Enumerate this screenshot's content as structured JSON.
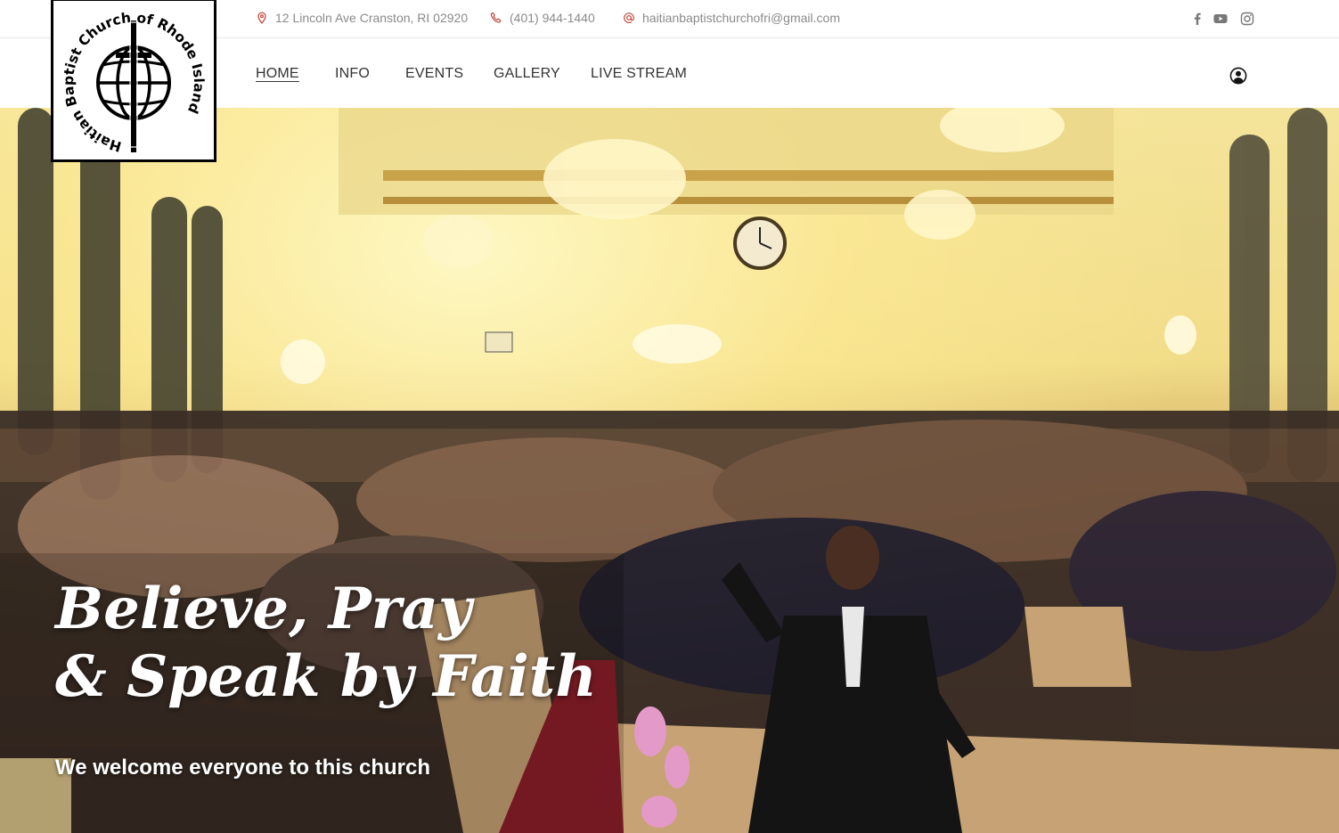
{
  "contact": {
    "address": "12 Lincoln Ave Cranston, RI 02920",
    "phone": "(401) 944-1440",
    "email": "haitianbaptistchurchofri@gmail.com"
  },
  "logo": {
    "text": "Haitian Baptist Church of Rhode Island"
  },
  "nav": {
    "items": [
      {
        "label": "HOME",
        "active": true
      },
      {
        "label": "INFO"
      },
      {
        "label": "EVENTS"
      },
      {
        "label": "GALLERY"
      },
      {
        "label": "LIVE STREAM"
      }
    ]
  },
  "social": [
    "facebook-icon",
    "youtube-icon",
    "instagram-icon"
  ],
  "hero": {
    "title_line1": "Believe, Pray",
    "title_line2": "& Speak by Faith",
    "subtitle": "We welcome everyone to this church"
  },
  "colors": {
    "text_dark": "#333333",
    "text_muted": "#8a8a8a",
    "accent_icon": "#c0392b"
  }
}
